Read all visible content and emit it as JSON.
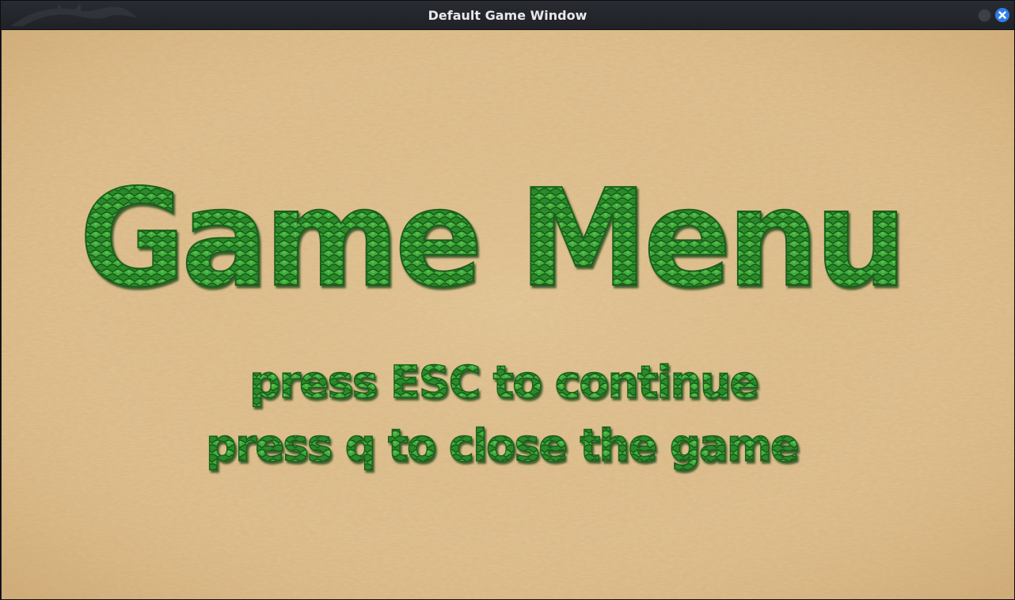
{
  "window": {
    "title": "Default Game Window",
    "accent_color": "#2f7fe6",
    "minimize_icon": "minimize-circle-icon",
    "close_icon": "close-x-icon"
  },
  "scene": {
    "background": "sand texture",
    "sand_color": "#dcb985",
    "text_texture": "green snake scales",
    "text_color": "#2b8a2e",
    "title": "Game Menu",
    "instructions": [
      "press ESC to continue",
      "press q to close the game"
    ]
  }
}
